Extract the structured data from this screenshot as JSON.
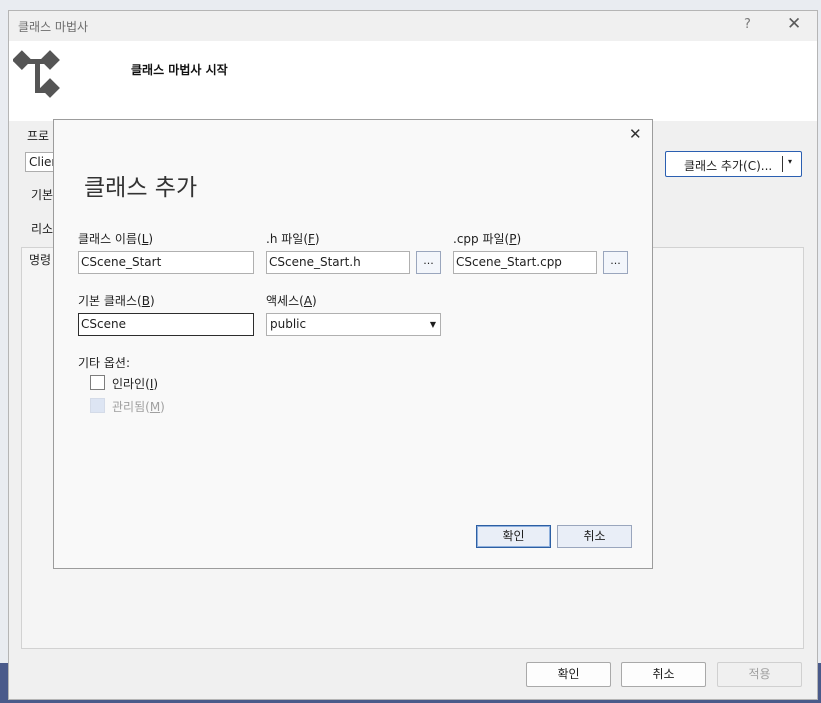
{
  "window": {
    "title": "클래스 마법사",
    "help": "?",
    "close": "✕",
    "banner_title": "클래스 마법사 시작"
  },
  "left_panel": {
    "project_label": "프로",
    "project_value": "Clien",
    "base_label": "기본",
    "resource_label": "리소",
    "tab_label": "명령"
  },
  "add_class_split": {
    "label": "클래스 추가(C)...",
    "arrow": "▾"
  },
  "bottom_buttons": {
    "ok": "확인",
    "cancel": "취소",
    "apply": "적용"
  },
  "dialog": {
    "close": "✕",
    "title": "클래스 추가",
    "class_name": {
      "label": "클래스 이름",
      "key": "L",
      "value": "CScene_Start"
    },
    "h_file": {
      "label": ".h 파일",
      "key": "F",
      "value": "CScene_Start.h"
    },
    "cpp_file": {
      "label": ".cpp 파일",
      "key": "P",
      "value": "CScene_Start.cpp"
    },
    "browse": "...",
    "base_class": {
      "label": "기본 클래스",
      "key": "B",
      "value": "CScene"
    },
    "access": {
      "label": "액세스",
      "key": "A",
      "value": "public"
    },
    "other_options_label": "기타 옵션:",
    "inline": {
      "label": "인라인",
      "key": "I",
      "checked": false
    },
    "managed": {
      "label": "관리됨",
      "key": "M",
      "checked": false,
      "disabled": true
    },
    "ok": "확인",
    "cancel": "취소"
  },
  "colors": {
    "accent": "#2b5fb1",
    "taskbar": "#4a5a8a",
    "disabled_text": "#a0a0a0"
  },
  "icons": [
    "class-wizard-logo-icon",
    "close-icon",
    "help-icon",
    "chevron-down-icon"
  ]
}
